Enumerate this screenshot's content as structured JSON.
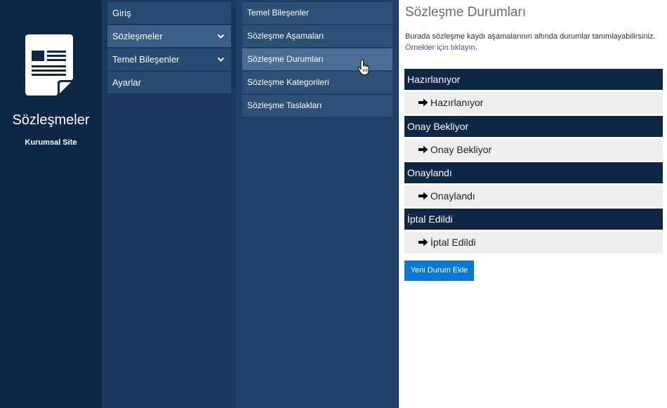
{
  "brand": {
    "icon": "document-icon",
    "title": "Sözleşmeler",
    "subtitle": "Kurumsal Site"
  },
  "nav1": {
    "items": [
      {
        "label": "Giriş",
        "expandable": false
      },
      {
        "label": "Sözleşmeler",
        "expandable": true,
        "icon": "chevron-down-icon"
      },
      {
        "label": "Temel Bileşenler",
        "expandable": true,
        "icon": "chevron-down-icon"
      },
      {
        "label": "Ayarlar",
        "expandable": false
      }
    ]
  },
  "nav2": {
    "items": [
      {
        "label": "Temel Bileşenler"
      },
      {
        "label": "Sözleşme Aşamaları"
      },
      {
        "label": "Sözleşme Durumları",
        "active": true
      },
      {
        "label": "Sözleşme Kategorileri"
      },
      {
        "label": "Sözleşme Taslakları"
      }
    ]
  },
  "main": {
    "title": "Sözleşme Durumları",
    "description": "Burada sözleşme kaydı aşamalarının altında durumlar tanımlayabilirsiniz.",
    "examples_link": "Örnekler için tıklayın",
    "examples_suffix": ".",
    "groups": [
      {
        "heading": "Hazırlanıyor",
        "item": "Hazırlanıyor"
      },
      {
        "heading": "Onay Bekliyor",
        "item": "Onay Bekliyor"
      },
      {
        "heading": "Onaylandı",
        "item": "Onaylandı"
      },
      {
        "heading": "İptal Edildi",
        "item": "İptal Edildi"
      }
    ],
    "add_button": "Yeni Durum Ekle"
  },
  "colors": {
    "brand_bg": "#0f2747",
    "nav1_bg": "#1a385d",
    "nav2_bg": "#1f4068",
    "group_head": "#0f2747",
    "group_row": "#efefef",
    "button": "#0a78d4",
    "link": "#2c58c7"
  }
}
